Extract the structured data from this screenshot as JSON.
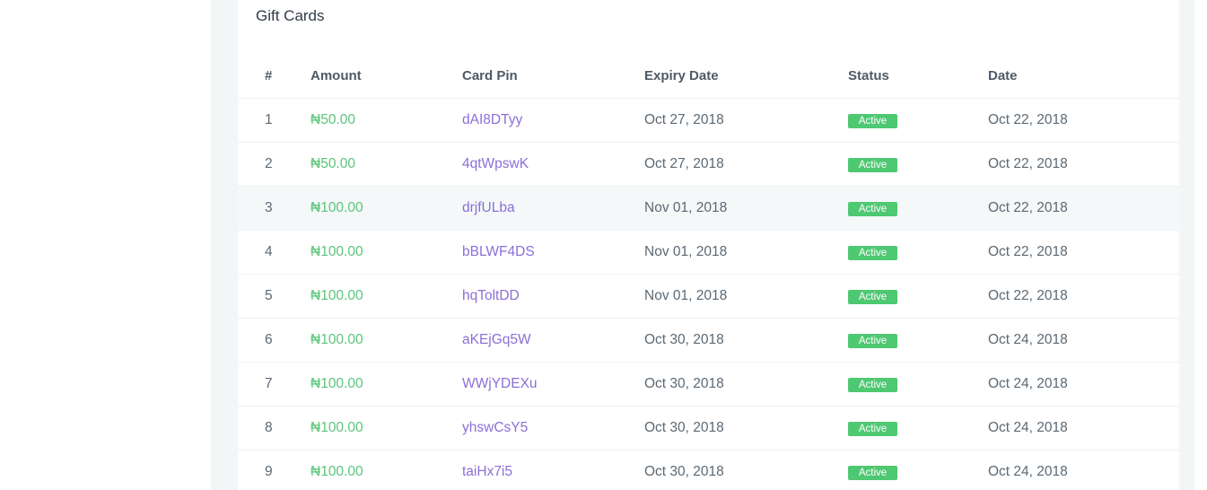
{
  "card": {
    "title": "Gift Cards"
  },
  "table": {
    "headers": {
      "num": "#",
      "amount": "Amount",
      "pin": "Card Pin",
      "expiry": "Expiry Date",
      "status": "Status",
      "date": "Date"
    },
    "rows": [
      {
        "num": "1",
        "amount": "₦50.00",
        "pin": "dAI8DTyy",
        "expiry": "Oct 27, 2018",
        "status": "Active",
        "date": "Oct 22, 2018"
      },
      {
        "num": "2",
        "amount": "₦50.00",
        "pin": "4qtWpswK",
        "expiry": "Oct 27, 2018",
        "status": "Active",
        "date": "Oct 22, 2018"
      },
      {
        "num": "3",
        "amount": "₦100.00",
        "pin": "drjfULba",
        "expiry": "Nov 01, 2018",
        "status": "Active",
        "date": "Oct 22, 2018"
      },
      {
        "num": "4",
        "amount": "₦100.00",
        "pin": "bBLWF4DS",
        "expiry": "Nov 01, 2018",
        "status": "Active",
        "date": "Oct 22, 2018"
      },
      {
        "num": "5",
        "amount": "₦100.00",
        "pin": "hqToltDD",
        "expiry": "Nov 01, 2018",
        "status": "Active",
        "date": "Oct 22, 2018"
      },
      {
        "num": "6",
        "amount": "₦100.00",
        "pin": "aKEjGq5W",
        "expiry": "Oct 30, 2018",
        "status": "Active",
        "date": "Oct 24, 2018"
      },
      {
        "num": "7",
        "amount": "₦100.00",
        "pin": "WWjYDEXu",
        "expiry": "Oct 30, 2018",
        "status": "Active",
        "date": "Oct 24, 2018"
      },
      {
        "num": "8",
        "amount": "₦100.00",
        "pin": "yhswCsY5",
        "expiry": "Oct 30, 2018",
        "status": "Active",
        "date": "Oct 24, 2018"
      },
      {
        "num": "9",
        "amount": "₦100.00",
        "pin": "taiHx7i5",
        "expiry": "Oct 30, 2018",
        "status": "Active",
        "date": "Oct 24, 2018"
      }
    ]
  },
  "colors": {
    "amount": "#5bc47a",
    "pin": "#8a6fd8",
    "status_badge": "#4fc872",
    "page_background": "#f2f6f7"
  }
}
